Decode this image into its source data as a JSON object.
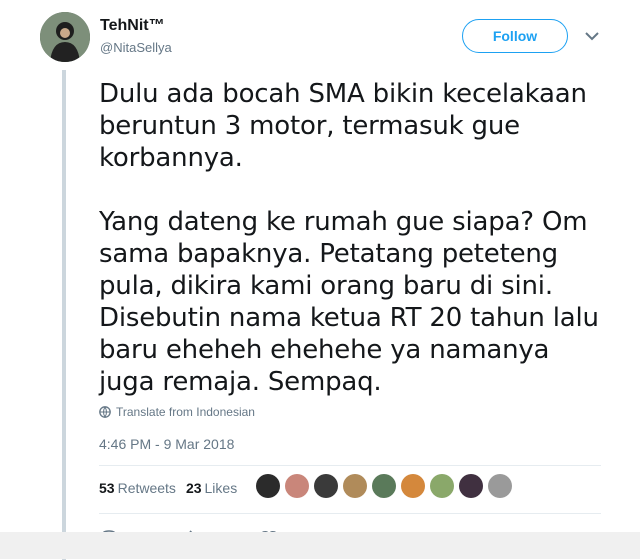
{
  "author": {
    "name": "TehNit™",
    "handle": "@NitaSellya"
  },
  "follow_label": "Follow",
  "tweet": {
    "paragraphs": [
      "Dulu ada bocah SMA bikin kecelakaan beruntun 3 motor, termasuk gue korbannya.",
      "Yang dateng ke rumah gue siapa? Om sama bapaknya. Petatang peteteng pula, dikira kami orang baru di sini. Disebutin nama ketua RT 20 tahun lalu baru eheheh ehehehe ya namanya juga remaja. Sempaq."
    ],
    "translate_label": "Translate from Indonesian",
    "timestamp": "4:46 PM - 9 Mar 2018"
  },
  "stats": {
    "retweets_count": "53",
    "retweets_label": "Retweets",
    "likes_count": "23",
    "likes_label": "Likes"
  },
  "liker_avatar_colors": [
    "#2b2b2b",
    "#c9867a",
    "#3a3a3a",
    "#b08b5a",
    "#5a7a5a",
    "#d4883c",
    "#8aa86a",
    "#403040",
    "#9a9a9a"
  ],
  "colors": {
    "accent": "#1da1f2",
    "text": "#14171a",
    "muted": "#657786",
    "thread_line": "#ccd6dd"
  }
}
